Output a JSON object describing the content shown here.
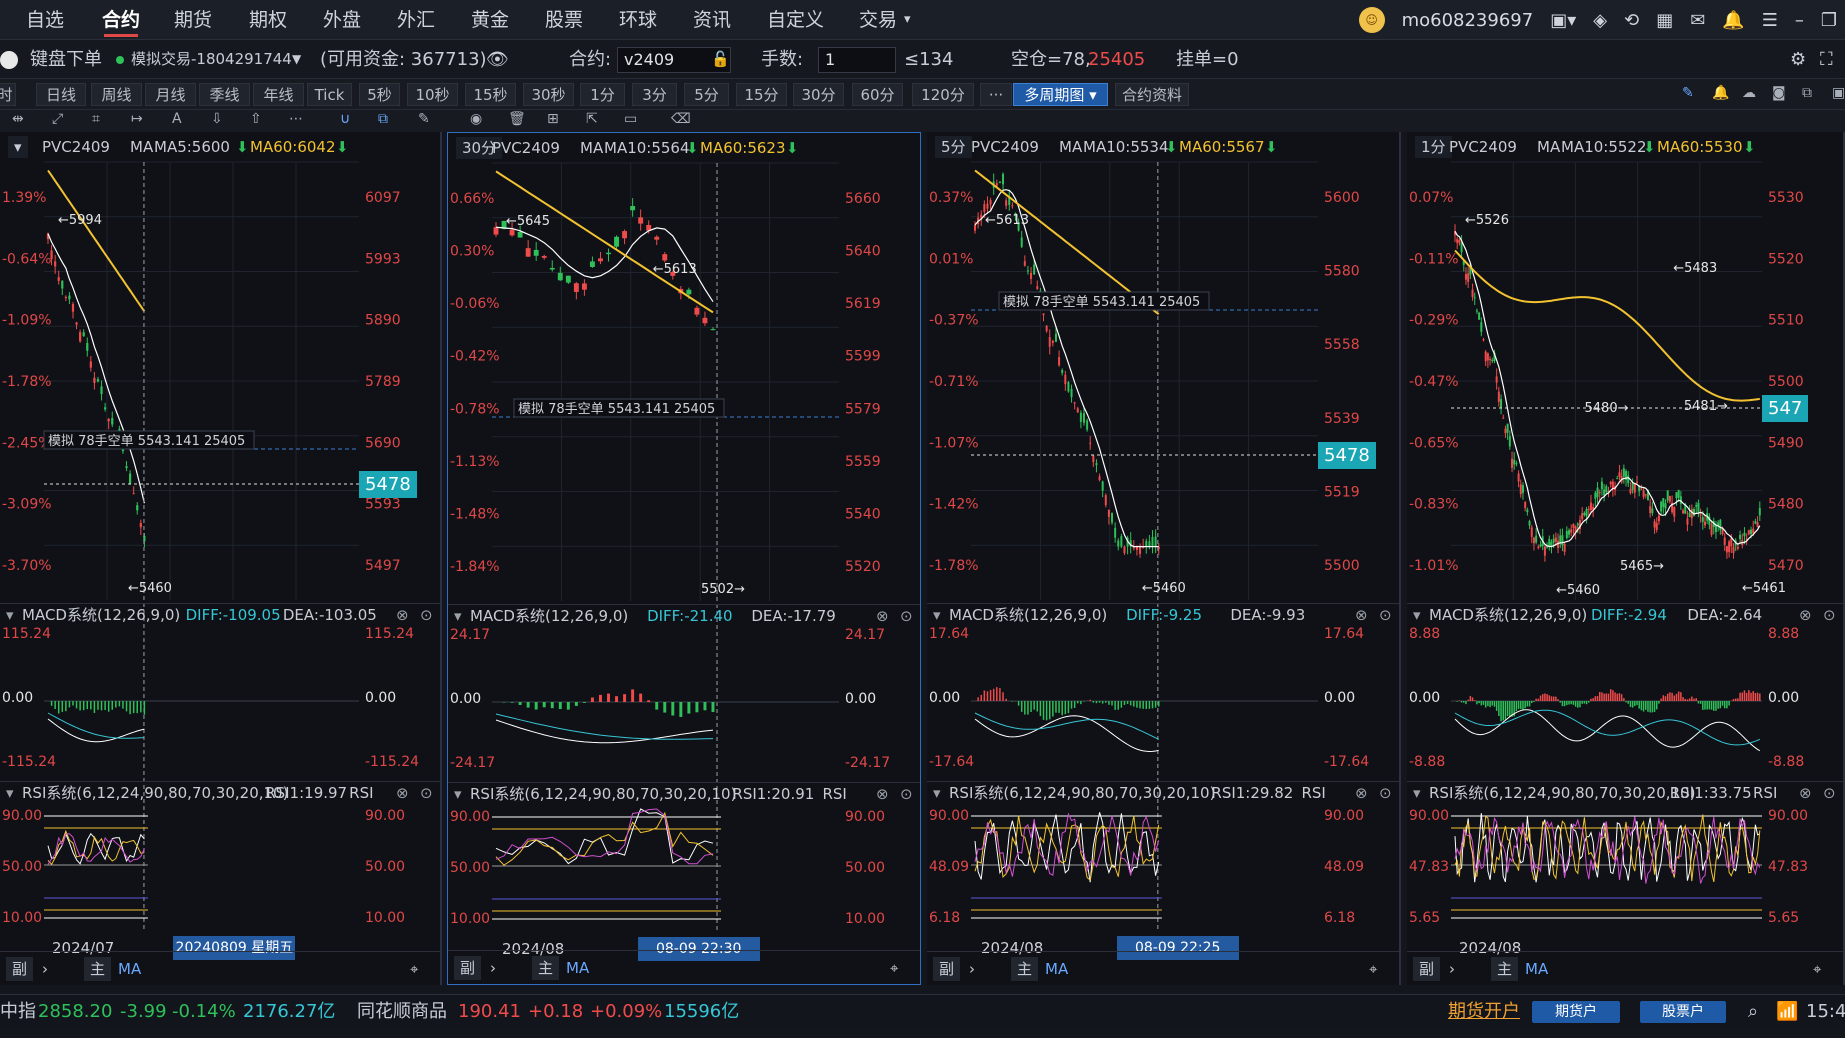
{
  "nav": {
    "tabs": [
      "自选",
      "合约",
      "期货",
      "期权",
      "外盘",
      "外汇",
      "黄金",
      "股票",
      "环球",
      "资讯",
      "自定义",
      "交易"
    ],
    "active": "合约",
    "user": "mo608239697"
  },
  "order": {
    "keyboard_label": "键盘下单",
    "account": "模拟交易-1804291744",
    "funds": "(可用资金: 367713)",
    "contract_label": "合约:",
    "contract_value": "v2409",
    "qty_label": "手数:",
    "qty_value": "1",
    "max": "≤134",
    "position_label": "空仓=78,",
    "position_value": "25405",
    "pending": "挂单=0"
  },
  "periods": [
    "时",
    "日线",
    "周线",
    "月线",
    "季线",
    "年线",
    "Tick",
    "5秒",
    "10秒",
    "15秒",
    "30秒",
    "1分",
    "3分",
    "5分",
    "15分",
    "30分",
    "60分",
    "120分",
    "···",
    "多周期图 ▾",
    "合约资料"
  ],
  "panels": [
    {
      "period": "▾",
      "name": "PVC2409",
      "ma_label": "MA",
      "ma1": "MA5:5600",
      "ma2": "MA60:6042",
      "pct_labels": [
        "1.39%",
        "-0.64%",
        "-1.09%",
        "-1.78%",
        "-2.45%",
        "-3.09%",
        "-3.70%"
      ],
      "price_labels": [
        "6097",
        "5993",
        "5890",
        "5789",
        "5690",
        "5593",
        "5497"
      ],
      "hi_label": "←5994",
      "lo_label": "←5460",
      "badge": "5478",
      "position_tag": "模拟  78手空单  5543.141  25405",
      "macd_title": "MACD系统(12,26,9,0)",
      "macd_diff": "DIFF:-109.05",
      "macd_dea": "DEA:-103.05",
      "macd_axis": [
        "115.24",
        "0.00",
        "-115.24"
      ],
      "rsi_title": "RSI系统(6,12,24,90,80,70,30,20,10)",
      "rsi_val": "RSI1:19.97",
      "rsi_tail": "RSI",
      "rsi_axis": [
        "90.00",
        "50.00",
        "10.00"
      ],
      "date_left": "2024/07",
      "date_mid": "",
      "date_badge": "20240809 星期五"
    },
    {
      "period": "30分",
      "name": "PVC2409",
      "ma_label": "MA",
      "ma1": "MA10:5564",
      "ma2": "MA60:5623",
      "pct_labels": [
        "0.66%",
        "0.30%",
        "-0.06%",
        "-0.42%",
        "-0.78%",
        "-1.13%",
        "-1.48%",
        "-1.84%"
      ],
      "price_labels": [
        "5660",
        "5640",
        "5619",
        "5599",
        "5579",
        "5559",
        "5540",
        "5520"
      ],
      "hi_label": "←5645",
      "mid_label": "←5613",
      "lo_label": "5502→",
      "position_tag": "模拟  78手空单  5543.141  25405",
      "macd_title": "MACD系统(12,26,9,0)",
      "macd_diff": "DIFF:-21.40",
      "macd_dea": "DEA:-17.79",
      "macd_axis": [
        "24.17",
        "0.00",
        "-24.17"
      ],
      "rsi_title": "RSI系统(6,12,24,90,80,70,30,20,10)",
      "rsi_val": "RSI1:20.91",
      "rsi_tail": "RSI",
      "rsi_axis": [
        "90.00",
        "50.00",
        "10.00"
      ],
      "date_left": "2024/08",
      "date_mid": "08/09",
      "date_badge": "08-09 22:30"
    },
    {
      "period": "5分",
      "name": "PVC2409",
      "ma_label": "MA",
      "ma1": "MA10:5534",
      "ma2": "MA60:5567",
      "pct_labels": [
        "0.37%",
        "0.01%",
        "-0.37%",
        "-0.71%",
        "-1.07%",
        "-1.42%",
        "-1.78%"
      ],
      "price_labels": [
        "5600",
        "5580",
        "5558",
        "5539",
        "5519",
        "5500"
      ],
      "hi_label": "←5613",
      "lo_label": "←5460",
      "badge": "5478",
      "position_tag": "模拟  78手空单  5543.141  25405",
      "macd_title": "MACD系统(12,26,9,0)",
      "macd_diff": "DIFF:-9.25",
      "macd_dea": "DEA:-9.93",
      "macd_axis": [
        "17.64",
        "0.00",
        "-17.64"
      ],
      "rsi_title": "RSI系统(6,12,24,90,80,70,30,20,10)",
      "rsi_val": "RSI1:29.82",
      "rsi_tail": "RSI",
      "rsi_axis": [
        "90.00",
        "48.09",
        "6.18"
      ],
      "date_left": "2024/08",
      "date_mid": "",
      "date_badge": "08-09 22:25"
    },
    {
      "period": "1分",
      "name": "PVC2409",
      "ma_label": "MA",
      "ma1": "MA10:5522",
      "ma2": "MA60:5530",
      "pct_labels": [
        "0.07%",
        "-0.11%",
        "-0.29%",
        "-0.47%",
        "-0.65%",
        "-0.83%",
        "-1.01%"
      ],
      "price_labels": [
        "5530",
        "5520",
        "5510",
        "5500",
        "5490",
        "5480",
        "5470"
      ],
      "hi_label": "←5526",
      "lo_label": "←5461",
      "lo2_label": "←5460",
      "mid_label": "←5483",
      "mid2_label": "5480→",
      "mid3_label": "5481→",
      "mid4_label": "5465→",
      "badge": "547",
      "macd_title": "MACD系统(12,26,9,0)",
      "macd_diff": "DIFF:-2.94",
      "macd_dea": "DEA:-2.64",
      "macd_axis": [
        "8.88",
        "0.00",
        "-8.88"
      ],
      "rsi_title": "RSI系统(6,12,24,90,80,70,30,20,10)",
      "rsi_val": "RSI1:33.75",
      "rsi_tail": "RSI",
      "rsi_axis": [
        "90.00",
        "47.83",
        "5.65"
      ],
      "date_left": "2024/08",
      "date_mid": "",
      "date_badge": ""
    }
  ],
  "footer_ctrl": {
    "sub": "副",
    "main": "主",
    "ma": "MA"
  },
  "ticker": {
    "idx_name": "中指",
    "idx_price": "2858.20",
    "idx_chg": "-3.99",
    "idx_pct": "-0.14%",
    "idx_amt": "2176.27亿",
    "name2": "同花顺商品",
    "price2": "190.41",
    "chg2": "+0.18",
    "pct2": "+0.09%",
    "amt2": "15596亿",
    "open_link": "期货开户",
    "btn1": "期货户",
    "btn2": "股票户",
    "time": "15:4"
  },
  "colors": {
    "up": "#f04b4b",
    "down": "#2fc05a",
    "ma_yellow": "#f2c230",
    "accent": "#1e5aa6",
    "badge": "#1aa6b5"
  }
}
